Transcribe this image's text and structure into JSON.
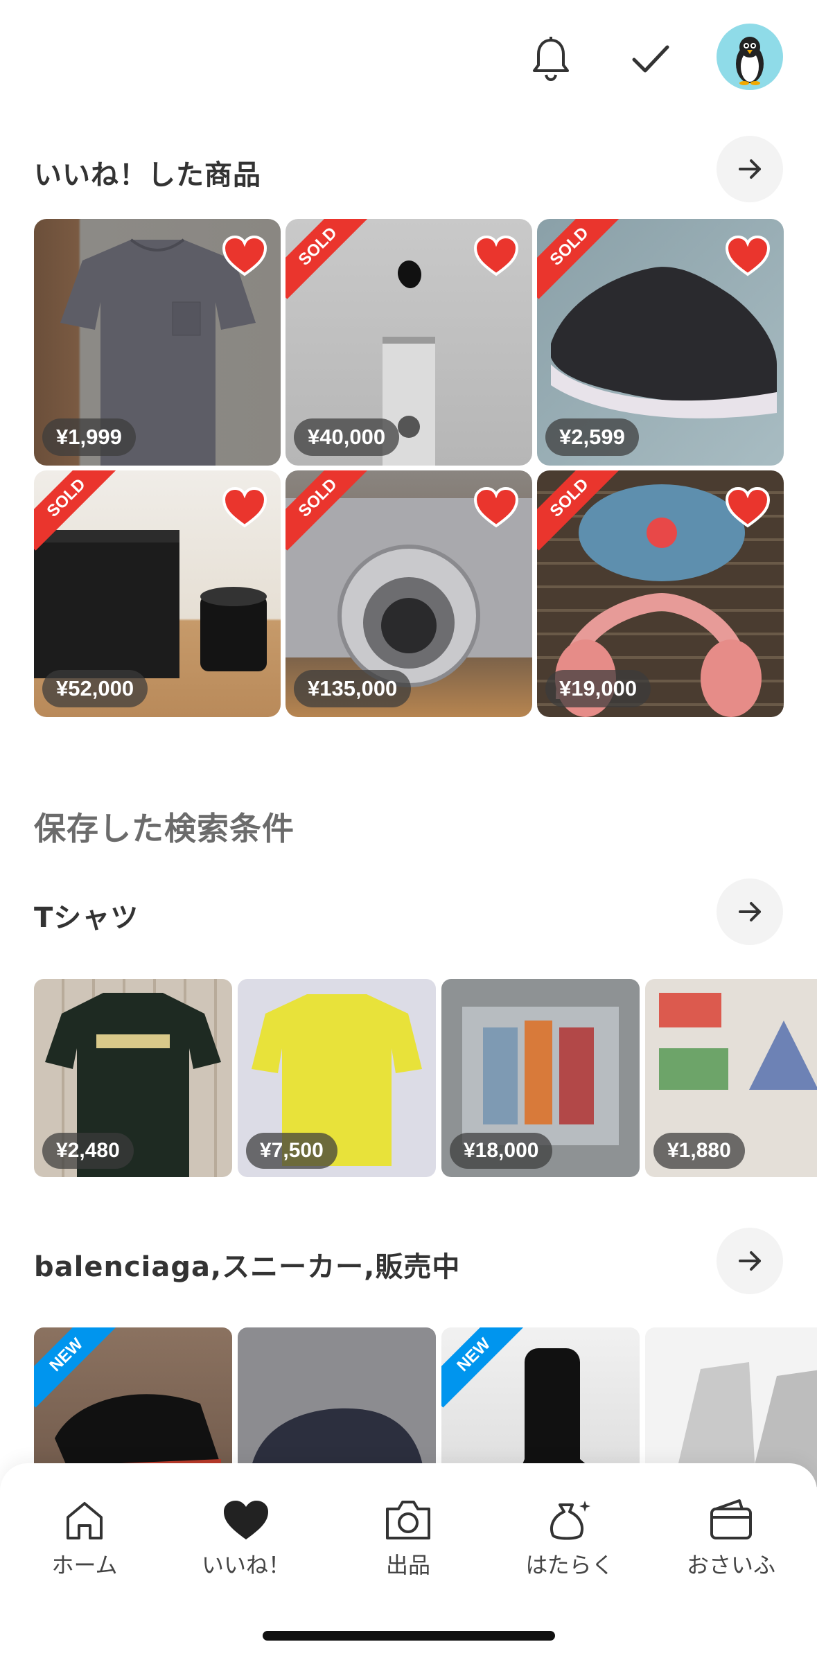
{
  "header": {
    "icons": [
      "bell-icon",
      "check-icon",
      "penguin-avatar"
    ]
  },
  "liked": {
    "title": "いいね！した商品",
    "items": [
      {
        "price": "¥1,999",
        "sold": false
      },
      {
        "price": "¥40,000",
        "sold": true
      },
      {
        "price": "¥2,599",
        "sold": true
      },
      {
        "price": "¥52,000",
        "sold": true
      },
      {
        "price": "¥135,000",
        "sold": true
      },
      {
        "price": "¥19,000",
        "sold": true
      }
    ]
  },
  "saved_searches": {
    "title": "保存した検索条件",
    "tshirt": {
      "label": "Tシャツ",
      "items": [
        {
          "price": "¥2,480"
        },
        {
          "price": "¥7,500"
        },
        {
          "price": "¥18,000"
        },
        {
          "price": "¥1,880"
        }
      ]
    },
    "balenciaga": {
      "label": "balenciaga,スニーカー,販売中",
      "items": [
        {
          "badge": "NEW"
        },
        {
          "badge": ""
        },
        {
          "badge": "NEW"
        },
        {
          "badge": ""
        }
      ]
    }
  },
  "ribbons": {
    "sold": "SOLD",
    "new": "NEW"
  },
  "bottom_nav": {
    "items": [
      {
        "label": "ホーム",
        "icon": "home-icon"
      },
      {
        "label": "いいね！",
        "icon": "heart-icon"
      },
      {
        "label": "出品",
        "icon": "camera-icon"
      },
      {
        "label": "はたらく",
        "icon": "bag-icon"
      },
      {
        "label": "おさいふ",
        "icon": "wallet-icon"
      }
    ]
  },
  "colors": {
    "accent": "#ea352d",
    "new_badge": "#0095ee",
    "text": "#333333"
  }
}
